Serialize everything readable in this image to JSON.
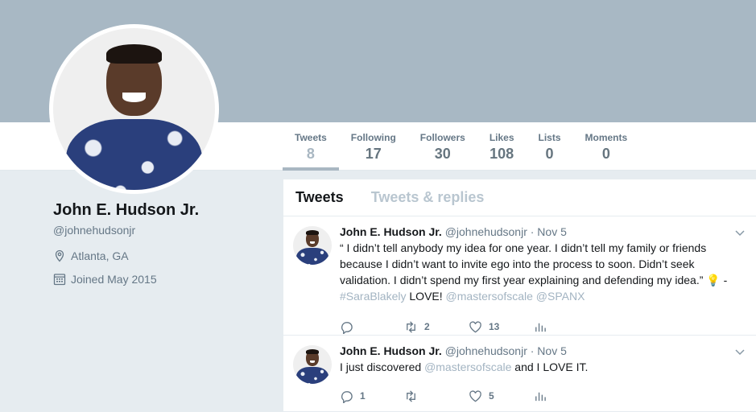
{
  "profile": {
    "name": "John E. Hudson Jr.",
    "handle": "@johnehudsonjr",
    "location": "Atlanta, GA",
    "joined": "Joined May 2015"
  },
  "nav": {
    "stats": [
      {
        "label": "Tweets",
        "value": "8",
        "active": true
      },
      {
        "label": "Following",
        "value": "17"
      },
      {
        "label": "Followers",
        "value": "30"
      },
      {
        "label": "Likes",
        "value": "108"
      },
      {
        "label": "Lists",
        "value": "0"
      },
      {
        "label": "Moments",
        "value": "0"
      }
    ]
  },
  "timeline": {
    "tabs": [
      {
        "label": "Tweets",
        "active": true
      },
      {
        "label": "Tweets & replies",
        "active": false
      }
    ],
    "tweets": [
      {
        "name": "John E. Hudson Jr.",
        "handle": "@johnehudsonjr",
        "time": "· Nov 5",
        "text_part1": "“ I didn’t tell anybody  my idea for one year. I didn’t tell my family or friends because I didn’t want to invite ego into the process to soon. Didn’t seek validation. I didn’t spend my first year explaining and defending my idea.” ",
        "emoji": "💡",
        "text_part2": " - ",
        "hashtag": "#SaraBlakely",
        "text_part3": " LOVE! ",
        "mention1": "@mastersofscale",
        "space": " ",
        "mention2": "@SPANX",
        "reply_count": "",
        "retweet_count": "2",
        "like_count": "13"
      },
      {
        "name": "John E. Hudson Jr.",
        "handle": "@johnehudsonjr",
        "time": "· Nov 5",
        "text_part1": "I just discovered ",
        "mention1": "@mastersofscale",
        "text_part2": " and I LOVE IT.",
        "reply_count": "1",
        "retweet_count": "",
        "like_count": "5"
      }
    ]
  },
  "colors": {
    "banner": "#a8b8c4",
    "link": "#a3b4c2",
    "active_stat": "#a9b7c2"
  },
  "icons": [
    "location-pin-icon",
    "calendar-icon",
    "reply-icon",
    "retweet-icon",
    "like-icon",
    "analytics-icon",
    "chevron-down-icon"
  ]
}
